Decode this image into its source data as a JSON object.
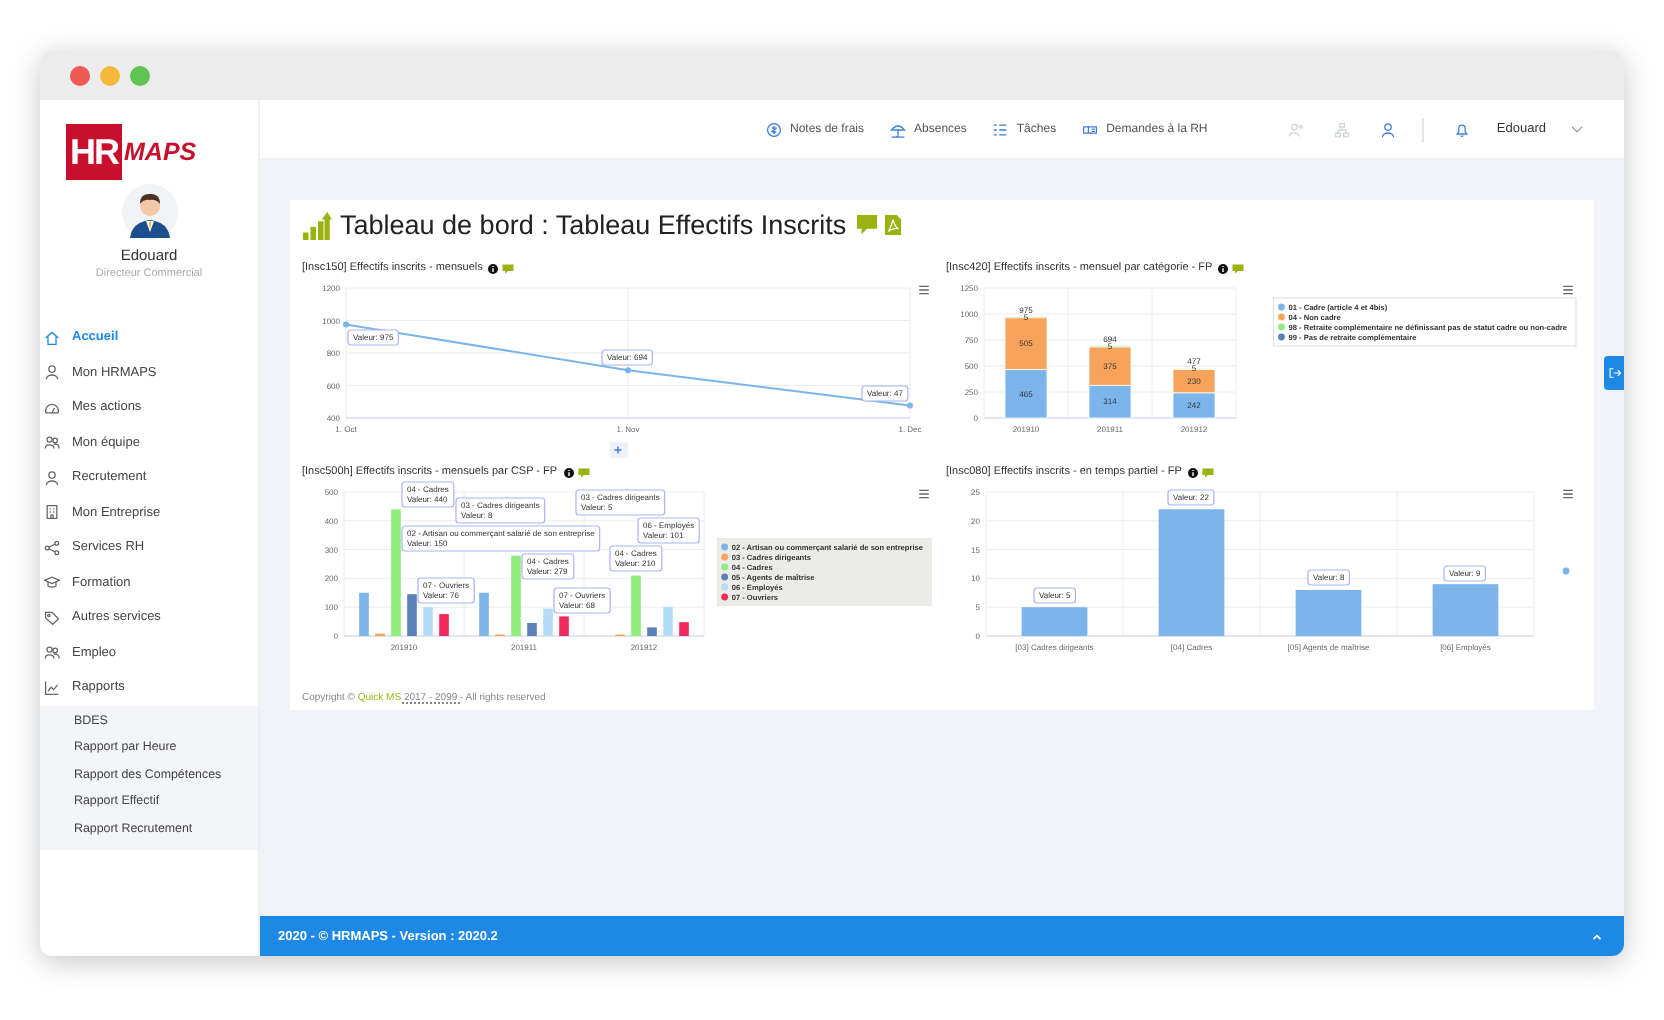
{
  "sidebar": {
    "logo": {
      "mark": "HR",
      "word": "MAPS"
    },
    "user": {
      "name": "Edouard",
      "role": "Directeur Commercial"
    },
    "menu": [
      {
        "label": "Accueil",
        "selected": true
      },
      {
        "label": "Mon HRMAPS",
        "selected": false
      },
      {
        "label": "Mes actions",
        "selected": false
      },
      {
        "label": "Mon équipe",
        "selected": false
      },
      {
        "label": "Recrutement",
        "selected": false
      },
      {
        "label": "Mon Entreprise",
        "selected": false
      },
      {
        "label": "Services RH",
        "selected": false
      },
      {
        "label": "Formation",
        "selected": false
      },
      {
        "label": "Autres services",
        "selected": false
      },
      {
        "label": "Empleo",
        "selected": false
      },
      {
        "label": "Rapports",
        "selected": false,
        "expanded": true,
        "children": [
          {
            "label": "BDES"
          },
          {
            "label": "Rapport par Heure"
          },
          {
            "label": "Rapport des Compétences"
          },
          {
            "label": "Rapport Effectif"
          },
          {
            "label": "Rapport Recrutement"
          }
        ]
      }
    ]
  },
  "topbar": {
    "links": [
      {
        "label": "Notes de frais"
      },
      {
        "label": "Absences"
      },
      {
        "label": "Tâches"
      },
      {
        "label": "Demandes à la RH"
      }
    ],
    "user": "Edouard"
  },
  "dashboard": {
    "title": "Tableau de bord : Tableau Effectifs Inscrits",
    "charts": [
      {
        "title": "[Insc150] Effectifs inscrits - mensuels",
        "chart_data": {
          "type": "line",
          "grid": true,
          "categories": [
            "1. Oct",
            "1. Nov",
            "1. Dec"
          ],
          "series": [
            {
              "color": "#7cb5ec",
              "marker": true,
              "values": [
                975,
                694,
                477
              ]
            }
          ],
          "ylim": [
            400,
            1200
          ],
          "yticks": [
            400,
            600,
            800,
            1000,
            1200
          ],
          "annotations": [
            {
              "x": "1. Oct",
              "y": 975,
              "text": "Valeur: 975"
            },
            {
              "x": "1. Nov",
              "y": 694,
              "text": "Valeur: 694"
            },
            {
              "x": "1. Dec",
              "y": 477,
              "text": "Valeur: 47"
            }
          ]
        }
      },
      {
        "title": "[Insc420] Effectifs inscrits - mensuel par catégorie - FP",
        "chart_data": {
          "type": "bar",
          "grid": true,
          "legend": "right",
          "stacked": true,
          "data_labels": true,
          "value_labels": [
            "975",
            "694",
            "477"
          ],
          "categories": [
            "201910",
            "201911",
            "201912"
          ],
          "series": [
            {
              "name": "01 - Cadre (article 4 et 4bis)",
              "color": "#7cb5ec",
              "values": [
                465,
                314,
                242
              ]
            },
            {
              "name": "04 - Non cadre",
              "color": "#f7a35c",
              "values": [
                505,
                375,
                230
              ]
            },
            {
              "name": "98 - Retraite complémentaire ne définissant pas de statut cadre ou non-cadre",
              "color": "#90ed7d",
              "values": [
                5,
                5,
                5
              ]
            },
            {
              "name": "99 - Pas de retraite complémentaire",
              "color": "#5b80b8",
              "values": [
                null,
                null,
                null
              ]
            }
          ],
          "ylim": [
            0,
            1250
          ],
          "yticks": [
            0,
            250,
            500,
            750,
            1000,
            1250
          ]
        }
      },
      {
        "title": "[Insc500h] Effectifs inscrits - mensuels par CSP - FP",
        "chart_data": {
          "type": "bar",
          "grid": true,
          "legend": "right",
          "stacked": false,
          "categories": [
            "201910",
            "201911",
            "201912"
          ],
          "series": [
            {
              "name": "02 - Artisan ou commerçant salarié de son entreprise",
              "color": "#7cb5ec",
              "values": [
                150,
                150,
                null
              ]
            },
            {
              "name": "03 - Cadres dirigeants",
              "color": "#f7a35c",
              "values": [
                8,
                5,
                5
              ]
            },
            {
              "name": "04 - Cadres",
              "color": "#90ed7d",
              "values": [
                440,
                279,
                210
              ]
            },
            {
              "name": "05 - Agents de maîtrise",
              "color": "#5b80b8",
              "values": [
                145,
                45,
                30
              ]
            },
            {
              "name": "06 - Employés",
              "color": "#b5dcf5",
              "values": [
                100,
                95,
                101
              ]
            },
            {
              "name": "07 - Ouvriers",
              "color": "#f2295b",
              "values": [
                76,
                68,
                48
              ]
            }
          ],
          "ylim": [
            0,
            500
          ],
          "yticks": [
            0,
            100,
            200,
            300,
            400,
            500
          ],
          "annotations": [
            "04 - Cadres\nValeur: 440",
            "02 - Artisan ou commerçant salarié de son entreprise\nValeur: 150",
            "07 - Ouvriers\nValeur: 76",
            "03 - Cadres dirigeants\nValeur: 8",
            "04 - Cadres\nValeur: 279",
            "07 - Ouvriers\nValeur: 68",
            "04 - Cadres\nValeur: 210",
            "06 - Employés\nValeur: 101",
            "03 - Cadres dirigeants\nValeur: 5"
          ]
        }
      },
      {
        "title": "[Insc080] Effectifs inscrits - en temps partiel - FP",
        "chart_data": {
          "type": "bar",
          "grid": true,
          "categories": [
            "[03] Cadres dirigeants",
            "[04] Cadres",
            "[05] Agents de maîtrise",
            "[06] Employés"
          ],
          "series": [
            {
              "color": "#7cb5ec",
              "values": [
                5,
                22,
                8,
                9
              ]
            }
          ],
          "ylim": [
            0,
            25
          ],
          "yticks": [
            0,
            5,
            10,
            15,
            20,
            25
          ],
          "annotations": [
            {
              "x": "[03] Cadres dirigeants",
              "y": 5,
              "text": "Valeur: 5"
            },
            {
              "x": "[04] Cadres",
              "y": 22,
              "text": "Valeur: 22"
            },
            {
              "x": "[05] Agents de maîtrise",
              "y": 8,
              "text": "Valeur: 8"
            },
            {
              "x": "[06] Employés",
              "y": 9,
              "text": "Valeur: 9"
            }
          ]
        }
      }
    ],
    "copyright": {
      "prefix": "Copyright ©",
      "link": "Quick MS",
      "years": "2017 - 2099 -",
      "suffix": "All rights reserved"
    }
  },
  "footer": {
    "text": "2020 - © HRMAPS - Version : 2020.2"
  }
}
